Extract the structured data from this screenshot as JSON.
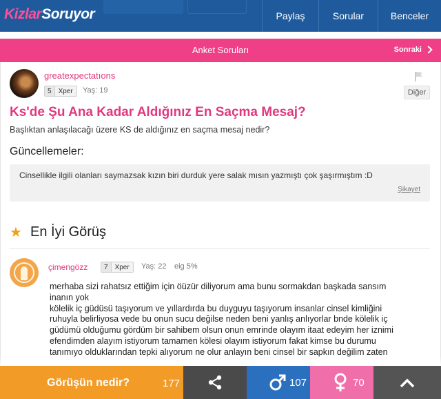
{
  "header": {
    "logo_part1": "Kizlar",
    "logo_part2": "S",
    "logo_part3": "oruyor",
    "nav": [
      "Paylaş",
      "Sorular",
      "Benceler"
    ]
  },
  "subheader": {
    "title": "Anket Soruları",
    "next_label": "Sonraki"
  },
  "question": {
    "author": "greatexpectatıons",
    "level": "5",
    "level_label": "Xper",
    "age": "Yaş: 19",
    "other_button": "Diğer",
    "title": "Ks'de Şu Ana Kadar Aldığınız En Saçma Mesaj?",
    "body": "Başlıktan anlaşılacağı üzere KS de aldığınız en saçma mesaj nedir?",
    "updates_heading": "Güncellemeler:",
    "update_text": "Cinsellikle ilgili olanları saymazsak kızın biri durduk yere salak mısın yazmıştı çok şaşırmıştım :D",
    "report_label": "Şikayet"
  },
  "best_opinion": {
    "heading": "En İyi Görüş",
    "author": "çimengözz",
    "level": "7",
    "level_label": "Xper",
    "age": "Yaş: 22",
    "agreement": "eig 5%",
    "lines": [
      "merhaba sizi rahatsız ettiğim için öüzür diliyorum ama bunu sormakdan başkada sansım",
      "inanın yok",
      "kölelik iç güdüsü taşıyorum ve yıllardırda bu duyguyu taşıyorum insanlar cinsel kimliğini",
      "ruhuyla belirliyosa vede bu onun sucu değilse neden beni yanlış anlıyorlar bnde kölelik iç",
      "güdümü olduğumu gördüm bir sahibem olsun onun emrinde olayım itaat edeyim her iznimi",
      "efendimden alayım istiyorum tamamen kölesi olayım istiyorum fakat kimse bu durumu",
      "tanımıyo olduklarından tepki alıyorum ne olur anlayın beni cinsel bir sapkın değilim zaten"
    ]
  },
  "bottom_bar": {
    "opinion_label": "Görüşün nedir?",
    "opinion_count": "177",
    "male_count": "107",
    "female_count": "70"
  },
  "colors": {
    "nav_blue": "#1f5b9c",
    "pink": "#ef3f87",
    "orange": "#f29b27",
    "male_blue": "#2b6fbf",
    "female_pink": "#f06faa"
  }
}
